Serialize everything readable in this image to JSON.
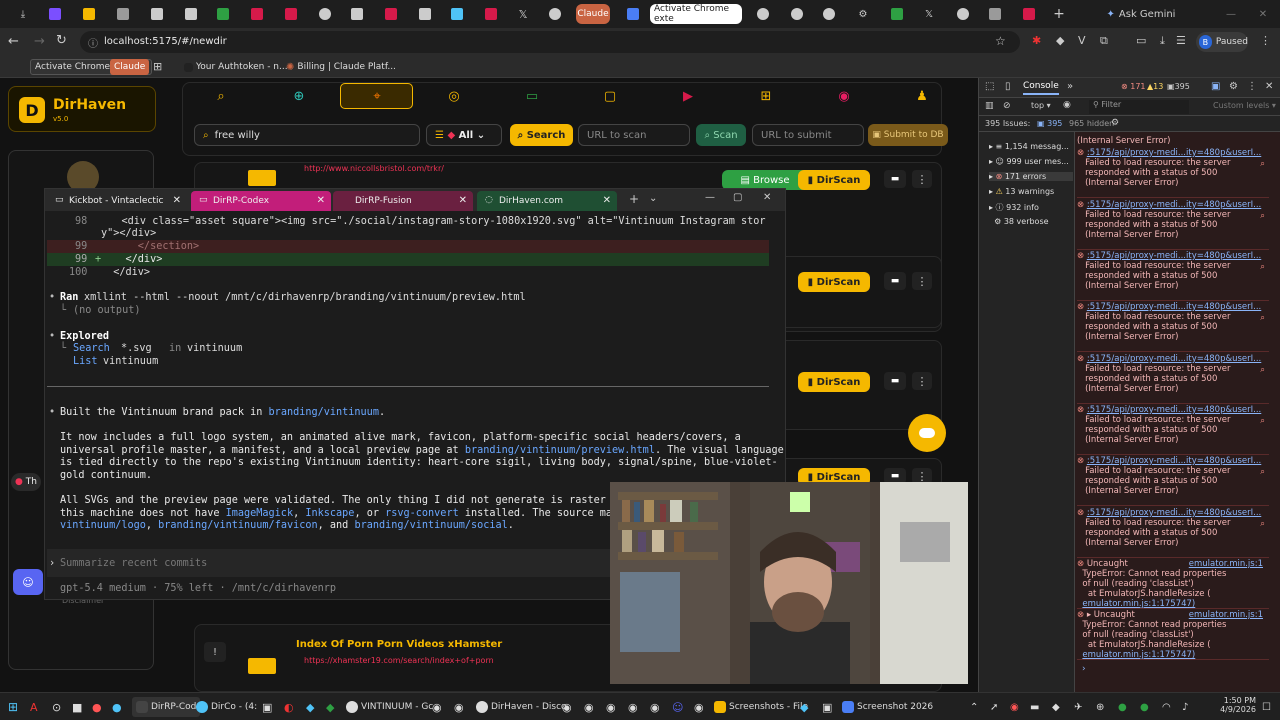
{
  "browser": {
    "tabs": [
      {
        "label": "",
        "color": "#8e8e8e"
      },
      {
        "label": "",
        "color": "#7b4fff"
      },
      {
        "label": "",
        "color": "#f5b800"
      },
      {
        "label": "",
        "color": "#9a9a9a"
      },
      {
        "label": "",
        "color": "#cccccc"
      },
      {
        "label": "",
        "color": "#cccccc"
      },
      {
        "label": "",
        "color": "#2ea043"
      },
      {
        "label": "",
        "color": "#d61a4a"
      },
      {
        "label": "",
        "color": "#d61a4a"
      },
      {
        "label": "",
        "color": "#cccccc"
      },
      {
        "label": "",
        "color": "#cccccc"
      },
      {
        "label": "",
        "color": "#d61a4a"
      },
      {
        "label": "",
        "color": "#cccccc"
      },
      {
        "label": "",
        "color": "#4fc3f7"
      },
      {
        "label": "",
        "color": "#d61a4a"
      },
      {
        "label": "",
        "color": "#cccccc"
      },
      {
        "label": "",
        "color": "#cccccc"
      }
    ],
    "claude_tab": "Claude",
    "active_tab": "Activate Chrome exte",
    "ask_gemini": "Ask Gemini",
    "url": "localhost:5175/#/newdir",
    "profile_status": "Paused",
    "profile_initial": "B",
    "bookmarks": [
      "Activate Chrome exten...",
      "Claude",
      "Your Authtoken - n...",
      "Billing | Claude Platf..."
    ]
  },
  "app": {
    "brand": "DirHaven",
    "version": "v5.0",
    "search_value": "free willy",
    "filter_label": "All",
    "search_button": "Search",
    "scan_placeholder": "URL to scan",
    "scan_button": "Scan",
    "submit_placeholder": "URL to submit",
    "submit_button": "Submit to DB",
    "browse_button": "Browse",
    "dirscan_button": "DirScan",
    "result_url_top": "http://www.niccollsbristol.com/trkr/",
    "result_title_bottom": "Index Of Porn Porn Videos xHamster",
    "result_url_bottom": "https://xhamster19.com/search/index+of+porn",
    "sidebar_th": "Th",
    "disclaimer": "Disclaimer"
  },
  "terminal": {
    "tabs": [
      "Kickbot - Vintaclectic",
      "DirRP-Codex",
      "DirRP-Fusion",
      "DirHaven.com"
    ],
    "lines": {
      "l98": "    <div class=\"asset square\"><img src=\"./social/instagram-story-1080x1920.svg\" alt=\"Vintinuum Instagram stor",
      "l98b": "y\"></div>",
      "l99a": "      </section>",
      "l99b": "    </div>",
      "l100": "  </div>",
      "ran_cmd": "xmllint --html --noout /mnt/c/dirhavenrp/branding/vintinuum/preview.html",
      "ran_label": "Ran",
      "no_output": "(no output)",
      "explored": "Explored",
      "search_label": "Search",
      "search_q": "*.svg",
      "search_in": "in",
      "search_dir": "vintinuum",
      "list_label": "List",
      "list_dir": "vintinuum",
      "built_pre": "Built the Vintinuum brand pack in ",
      "built_link": "branding/vintinuum",
      "built_post": ".",
      "p1_a": "It now includes a full logo system, an animated alive mark, favicon, platform-specific social headers/covers, a",
      "p1_b": "universal profile master, a manifest, and a local preview page at ",
      "p1_b_link": "branding/vintinuum/preview.html",
      "p1_b_post": ". The visual language",
      "p1_c": "is tied directly to the repo's existing Vintinuum identity: heart-core sigil, living body, signal/spine, blue-violet-",
      "p1_d": "gold continuum.",
      "p2_a": "All SVGs and the preview page were validated. The only thing I did not generate is raster PN",
      "p2_b_pre": "this machine does not have ",
      "p2_b_l1": "ImageMagick",
      "p2_b_l2": "Inkscape",
      "p2_b_mid": ", or ",
      "p2_b_l3": "rsvg-convert",
      "p2_b_post": " installed. The source mast",
      "p2_c_l1": "vintinuum/logo",
      "p2_c_l2": "branding/vintinuum/favicon",
      "p2_c_and": ", and ",
      "p2_c_l3": "branding/vintinuum/social",
      "prompt_placeholder": "Summarize recent commits",
      "status": "gpt-5.4 medium · 75% left · /mnt/c/dirhavenrp"
    },
    "line_numbers": [
      "98",
      "99",
      "99",
      "100"
    ]
  },
  "devtools": {
    "tab": "Console",
    "errors": "171",
    "warnings": "13",
    "infos": "395",
    "context": "top",
    "filter_placeholder": "Filter",
    "levels": "Custom levels",
    "issues": "395 Issues:",
    "issues_count": "395",
    "hidden": "965 hidden",
    "sidebar": [
      {
        "label": "1,154 messag..."
      },
      {
        "label": "999 user mes..."
      },
      {
        "label": "171 errors"
      },
      {
        "label": "13 warnings"
      },
      {
        "label": "932 info"
      },
      {
        "label": "38 verbose"
      }
    ],
    "first_line": "(Internal Server Error)",
    "error_link": ":5175/api/proxy-medi...ity=480p&userI...",
    "error_msg_1": "Failed to load resource: the server",
    "error_msg_2": "responded with a status of 500",
    "error_msg_3": "(Internal Server Error)",
    "uncaught": "Uncaught",
    "uncaught_file": "emulator.min.js:1",
    "type_error_1": "TypeError: Cannot read properties",
    "type_error_2": "of null (reading 'classList')",
    "type_error_3": "at EmulatorJS.handleResize (",
    "type_error_4": "emulator.min.js:1:175747)"
  },
  "taskbar": {
    "items": [
      "DirRP-Cod",
      "DirCo - (4:",
      "VINTINUUM - Gc",
      "DirHaven - Disco",
      "Screenshots - File",
      "Screenshot 2026"
    ],
    "time": "1:50 PM",
    "date": "4/9/2026"
  },
  "colors": {
    "accent": "#f5b800",
    "pink_tab": "#c21e7a",
    "diff_red": "#3d1f1f",
    "diff_green": "#1f3d22",
    "link": "#6aa7ff"
  }
}
